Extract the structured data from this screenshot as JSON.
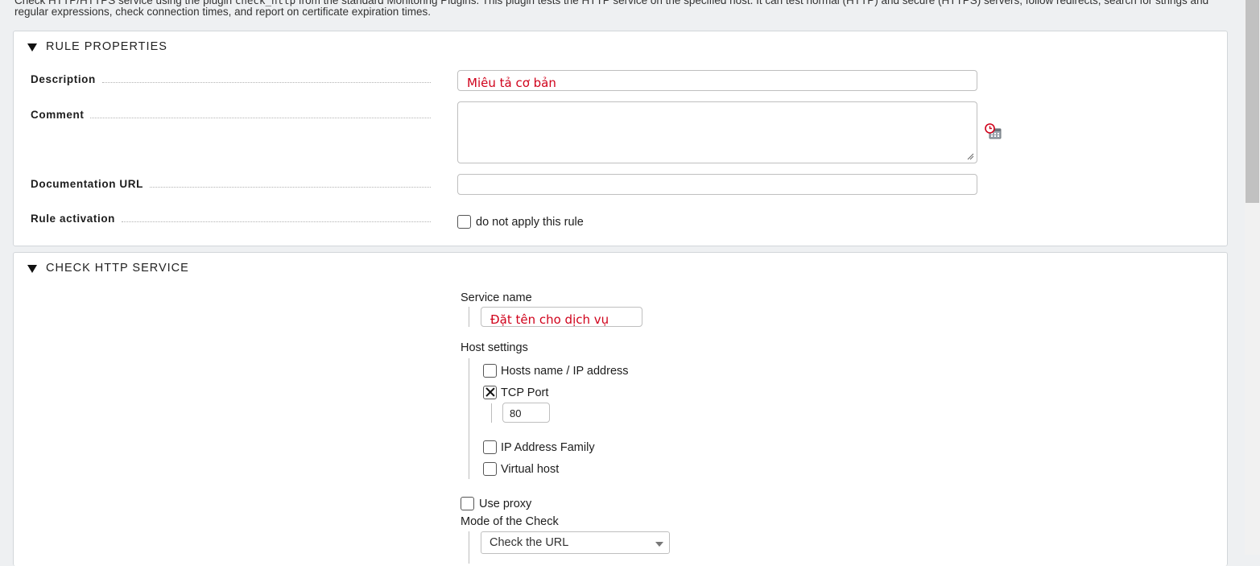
{
  "intro": {
    "part1": "Check HTTP/HTTPS service using the plugin ",
    "code": "check_http",
    "part2": " from the standard Monitoring Plugins. This plugin tests the HTTP service on the specified host. It can test normal (HTTP) and secure (HTTPS) servers, follow redirects, search for strings and regular expressions, check connection times, and report on certificate expiration times."
  },
  "rule_properties": {
    "title": "RULE PROPERTIES",
    "description_label": "Description",
    "description_value": "Miêu tả cơ bản",
    "comment_label": "Comment",
    "comment_value": "",
    "doc_url_label": "Documentation URL",
    "doc_url_value": "",
    "rule_activation_label": "Rule activation",
    "do_not_apply_label": "do not apply this rule",
    "do_not_apply_checked": false
  },
  "check_http": {
    "title": "CHECK HTTP SERVICE",
    "service_name_label": "Service name",
    "service_name_value": "Đặt tên cho dịch vụ",
    "host_settings_label": "Host settings",
    "hosts_name_label": "Hosts name / IP address",
    "tcp_port_label": "TCP Port",
    "tcp_port_value": "80",
    "ip_family_label": "IP Address Family",
    "virtual_host_label": "Virtual host",
    "use_proxy_label": "Use proxy",
    "mode_label": "Mode of the Check",
    "mode_value": "Check the URL"
  },
  "colors": {
    "placeholder_red": "#d0021b",
    "page_bg": "#eef0f2"
  }
}
